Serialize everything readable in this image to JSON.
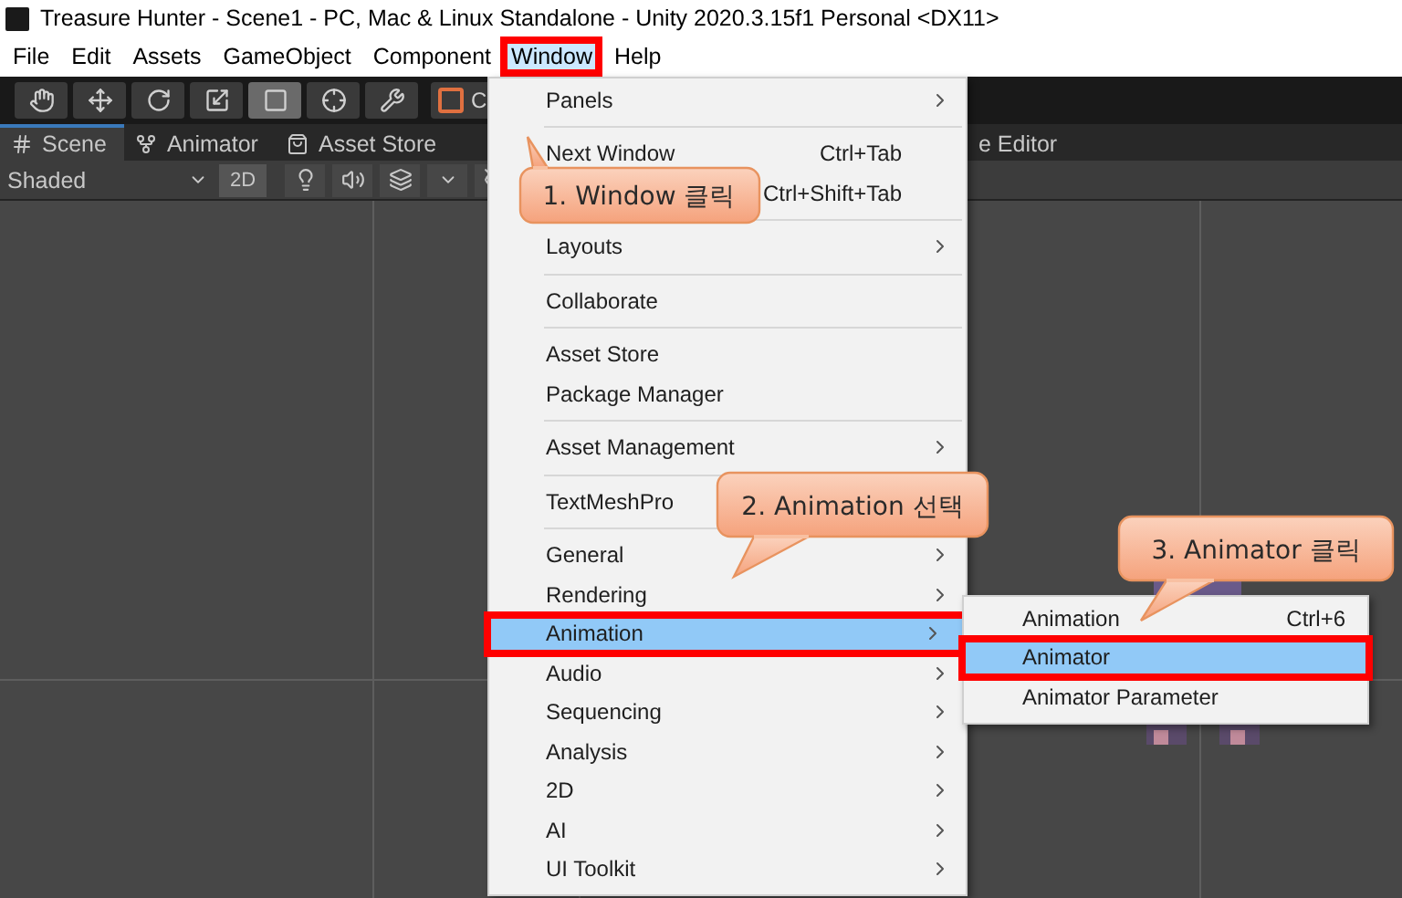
{
  "window": {
    "title": "Treasure Hunter - Scene1 - PC, Mac & Linux Standalone - Unity 2020.3.15f1 Personal <DX11>"
  },
  "menu_bar": [
    {
      "label": "File",
      "highlighted": false
    },
    {
      "label": "Edit",
      "highlighted": false
    },
    {
      "label": "Assets",
      "highlighted": false
    },
    {
      "label": "GameObject",
      "highlighted": false
    },
    {
      "label": "Component",
      "highlighted": false
    },
    {
      "label": "Window",
      "highlighted": true
    },
    {
      "label": "Help",
      "highlighted": false
    }
  ],
  "toolbar": {
    "tools": [
      {
        "kind": "hand",
        "selected": false
      },
      {
        "kind": "move",
        "selected": false
      },
      {
        "kind": "rotate",
        "selected": false
      },
      {
        "kind": "scale",
        "selected": false
      },
      {
        "kind": "rect",
        "selected": true
      },
      {
        "kind": "transform",
        "selected": false
      },
      {
        "kind": "custom",
        "selected": false
      }
    ],
    "collab_button": {
      "label": "C"
    }
  },
  "tabs": [
    {
      "kind": "scene",
      "label": "Scene",
      "selected": true
    },
    {
      "kind": "animator",
      "label": "Animator",
      "selected": false
    },
    {
      "kind": "store",
      "label": "Asset Store",
      "selected": false
    },
    {
      "kind": "plain",
      "label": "e Editor",
      "selected": false
    }
  ],
  "scene_toolbar": {
    "shading": "Shaded",
    "mode_2d": "2D"
  },
  "window_menu": {
    "groups": [
      {
        "items": [
          {
            "label": "Panels",
            "submenu": true,
            "selected": false,
            "highlighted": false
          }
        ]
      },
      {
        "items": [
          {
            "label": "Next Window",
            "shortcut": "Ctrl+Tab",
            "submenu": false,
            "selected": false,
            "highlighted": false
          },
          {
            "shortcut": "Ctrl+Shift+Tab",
            "submenu": false,
            "selected": false,
            "highlighted": false
          }
        ]
      },
      {
        "items": [
          {
            "label": "Layouts",
            "submenu": true,
            "selected": false,
            "highlighted": false
          }
        ]
      },
      {
        "items": [
          {
            "label": "Collaborate",
            "submenu": false,
            "selected": false,
            "highlighted": false
          }
        ]
      },
      {
        "items": [
          {
            "label": "Asset Store",
            "submenu": false,
            "selected": false,
            "highlighted": false
          },
          {
            "label": "Package Manager",
            "submenu": false,
            "selected": false,
            "highlighted": false
          }
        ]
      },
      {
        "items": [
          {
            "label": "Asset Management",
            "submenu": true,
            "selected": false,
            "highlighted": false
          }
        ]
      },
      {
        "items": [
          {
            "label": "TextMeshPro",
            "selected": false,
            "highlighted": false
          }
        ]
      },
      {
        "items": [
          {
            "label": "General",
            "submenu": true,
            "selected": false,
            "highlighted": false
          },
          {
            "label": "Rendering",
            "submenu": true,
            "selected": false,
            "highlighted": false
          },
          {
            "label": "Animation",
            "submenu": true,
            "selected": true,
            "highlighted": true
          },
          {
            "label": "Audio",
            "submenu": true,
            "selected": false,
            "highlighted": false
          },
          {
            "label": "Sequencing",
            "submenu": true,
            "selected": false,
            "highlighted": false
          },
          {
            "label": "Analysis",
            "submenu": true,
            "selected": false,
            "highlighted": false
          },
          {
            "label": "2D",
            "submenu": true,
            "selected": false,
            "highlighted": false
          },
          {
            "label": "AI",
            "submenu": true,
            "selected": false,
            "highlighted": false
          },
          {
            "label": "UI Toolkit",
            "submenu": true,
            "selected": false,
            "highlighted": false
          }
        ]
      }
    ]
  },
  "animation_submenu": {
    "items": [
      {
        "label": "Animation",
        "shortcut": "Ctrl+6",
        "selected": false,
        "highlighted": false
      },
      {
        "label": "Animator",
        "selected": true,
        "highlighted": true
      },
      {
        "label": "Animator Parameter",
        "selected": false,
        "highlighted": false
      }
    ]
  },
  "callouts": [
    {
      "text": "1. Window 클릭"
    },
    {
      "text": "2. Animation 선택"
    },
    {
      "text": "3. Animator 클릭"
    }
  ]
}
